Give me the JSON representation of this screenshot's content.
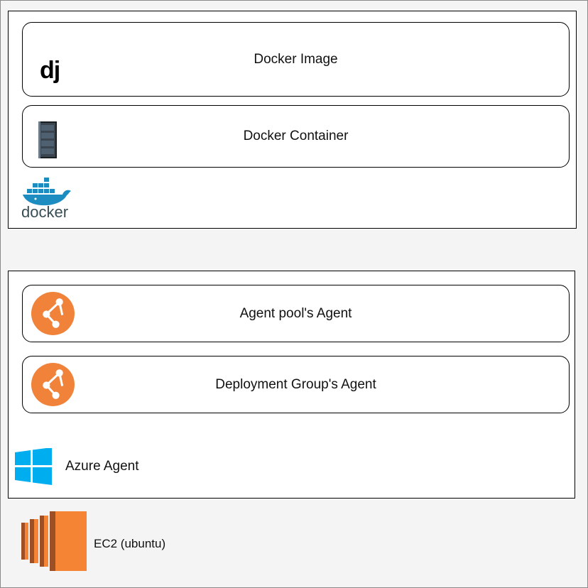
{
  "docker_group": {
    "image_card": {
      "label": "Docker Image",
      "logo_text": "dj"
    },
    "container_card": {
      "label": "Docker Container"
    },
    "docker_logo_text": "docker"
  },
  "azure_group": {
    "pool_agent_card": {
      "label": "Agent pool's Agent"
    },
    "deployment_agent_card": {
      "label": "Deployment Group's Agent"
    },
    "azure_label": "Azure Agent"
  },
  "ec2": {
    "label": "EC2 (ubuntu)"
  },
  "colors": {
    "docker_blue": "#1d8cc0",
    "agent_orange": "#f0823a",
    "windows_blue": "#00adef",
    "ec2_orange": "#f58534"
  }
}
